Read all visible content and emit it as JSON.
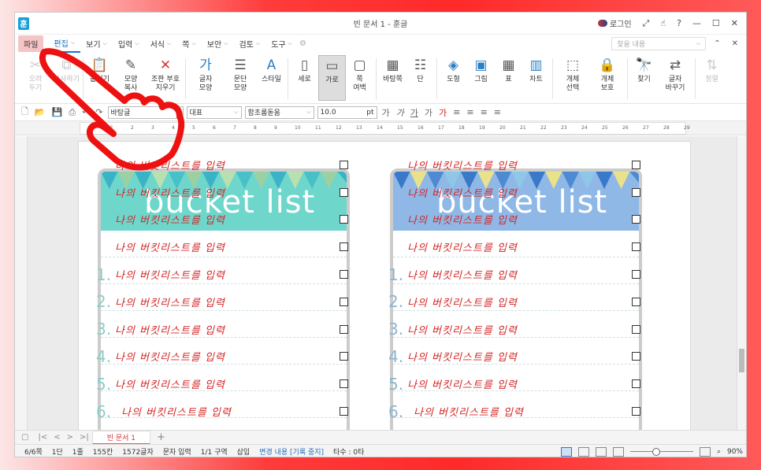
{
  "window": {
    "title": "빈 문서 1 - 훈글",
    "app_icon": "훈",
    "login": "로그인"
  },
  "menu": {
    "items": [
      "파일",
      "편집",
      "보기",
      "입력",
      "서식",
      "쪽",
      "보안",
      "검토",
      "도구"
    ],
    "find_placeholder": "찾을 내용"
  },
  "ribbon": {
    "groups": [
      {
        "label": "오려\n두기",
        "icon": "scissors-icon",
        "dim": true
      },
      {
        "label": "복사하기",
        "icon": "copy-icon",
        "dim": true
      },
      {
        "label": "붙이기",
        "icon": "paste-icon"
      },
      {
        "label": "모양\n복사",
        "icon": "format-painter-icon"
      },
      {
        "label": "조판 부호\n지우기",
        "icon": "clear-codes-icon"
      },
      {
        "label": "글자\n모양",
        "icon": "char-shape-icon"
      },
      {
        "label": "문단\n모양",
        "icon": "para-shape-icon"
      },
      {
        "label": "스타일",
        "icon": "style-icon"
      },
      {
        "label": "세로",
        "icon": "portrait-icon"
      },
      {
        "label": "가로",
        "icon": "landscape-icon",
        "selected": true
      },
      {
        "label": "쪽\n여백",
        "icon": "margin-icon"
      },
      {
        "label": "바탕쪽",
        "icon": "master-page-icon"
      },
      {
        "label": "단",
        "icon": "columns-icon"
      },
      {
        "label": "도형",
        "icon": "shape-icon"
      },
      {
        "label": "그림",
        "icon": "picture-icon"
      },
      {
        "label": "표",
        "icon": "table-icon"
      },
      {
        "label": "차트",
        "icon": "chart-icon"
      },
      {
        "label": "개체\n선택",
        "icon": "object-select-icon"
      },
      {
        "label": "개체\n보호",
        "icon": "object-protect-icon"
      },
      {
        "label": "찾기",
        "icon": "find-icon"
      },
      {
        "label": "글자\n바꾸기",
        "icon": "replace-icon"
      },
      {
        "label": "정렬",
        "icon": "sort-icon",
        "dim": true
      }
    ]
  },
  "toolbar": {
    "style": "바탕글",
    "lang": "대표",
    "font": "함초롬돋움",
    "size": "10.0",
    "unit": "pt"
  },
  "ruler_ticks": [
    "1",
    "2",
    "3",
    "4",
    "5",
    "6",
    "7",
    "8",
    "9",
    "10",
    "11",
    "12",
    "13",
    "14",
    "15",
    "16",
    "17",
    "18",
    "19",
    "20",
    "21",
    "22",
    "23",
    "24",
    "25",
    "26",
    "27",
    "28",
    "29"
  ],
  "document": {
    "card_title": "bucket list",
    "item_text": "나의 버킷리스트를 입력",
    "numbers": [
      "",
      "",
      "",
      "",
      "1.",
      "2.",
      "3.",
      "4.",
      "5.",
      "6."
    ]
  },
  "tabs": {
    "doc_tab": "빈 문서 1"
  },
  "status": {
    "page": "6/6쪽",
    "col": "1단",
    "line": "1줄",
    "pos": "155칸",
    "chars": "1572글자",
    "mode": "문자 입력",
    "section": "1/1 구역",
    "insert": "삽입",
    "track": "변경 내용 [기록 중지]",
    "typo": "타수 : 0타",
    "zoom": "90%"
  },
  "colors": {
    "accent": "#1a73c8",
    "text_red": "#d32424",
    "teal": "#6ed6cb",
    "blue": "#8fb8e6"
  }
}
